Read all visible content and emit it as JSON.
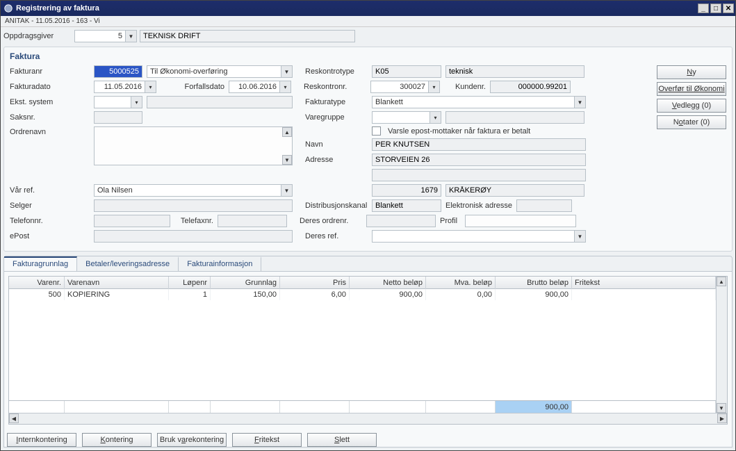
{
  "window": {
    "title": "Registrering av faktura",
    "subtitle": "ANITAK - 11.05.2016 - 163 - Vi"
  },
  "top": {
    "oppdragsgiver_label": "Oppdragsgiver",
    "oppdragsgiver_value": "5",
    "oppdragsgiver_text": "TEKNISK DRIFT"
  },
  "section_faktura_title": "Faktura",
  "labels": {
    "fakturanr": "Fakturanr",
    "fakturadato": "Fakturadato",
    "forfallsdato": "Forfallsdato",
    "ekst_system": "Ekst. system",
    "saksnr": "Saksnr.",
    "ordrenavn": "Ordrenavn",
    "vaar_ref": "Vår ref.",
    "selger": "Selger",
    "telefonnr": "Telefonnr.",
    "telefaxnr": "Telefaxnr.",
    "epost": "ePost",
    "reskontrotype": "Reskontrotype",
    "reskontronr": "Reskontronr.",
    "kundenr": "Kundenr.",
    "fakturatype": "Fakturatype",
    "varegruppe": "Varegruppe",
    "varsle": "Varsle epost-mottaker når faktura er betalt",
    "navn": "Navn",
    "adresse": "Adresse",
    "distribusjonskanal": "Distribusjonskanal",
    "elektronisk_adresse": "Elektronisk adresse",
    "deres_ordrenr": "Deres ordrenr.",
    "profil": "Profil",
    "deres_ref": "Deres ref."
  },
  "values": {
    "fakturanr": "5000525",
    "fakturanr_select": "Til Økonomi-overføring",
    "fakturadato": "11.05.2016",
    "forfallsdato": "10.06.2016",
    "reskontrotype": "K05",
    "reskontrotype_text": "teknisk",
    "reskontronr": "300027",
    "kundenr": "000000.99201",
    "fakturatype": "Blankett",
    "navn": "PER KNUTSEN",
    "adresse1": "STORVEIEN 26",
    "postnr": "1679",
    "poststed": "KRÅKERØY",
    "vaar_ref": "Ola Nilsen",
    "distribusjonskanal": "Blankett"
  },
  "buttons": {
    "ny": "Ny",
    "overfor": "Overfør til Økonomi",
    "vedlegg": "Vedlegg (0)",
    "notater": "Notater (0)",
    "internkontering": "Internkontering",
    "kontering": "Kontering",
    "bruk_varekontering": "Bruk varekontering",
    "fritekst": "Fritekst",
    "slett": "Slett"
  },
  "tabs": {
    "t1": "Fakturagrunnlag",
    "t2": "Betaler/leveringsadresse",
    "t3": "Fakturainformasjon"
  },
  "grid": {
    "headers": {
      "varenr": "Varenr.",
      "varenavn": "Varenavn",
      "lopenr": "Løpenr",
      "grunnlag": "Grunnlag",
      "pris": "Pris",
      "netto": "Netto beløp",
      "mva": "Mva. beløp",
      "brutto": "Brutto beløp",
      "fritekst": "Fritekst"
    },
    "rows": [
      {
        "varenr": "500",
        "varenavn": "KOPIERING",
        "lopenr": "1",
        "grunnlag": "150,00",
        "pris": "6,00",
        "netto": "900,00",
        "mva": "0,00",
        "brutto": "900,00",
        "fritekst": ""
      }
    ],
    "total_brutto": "900,00"
  }
}
